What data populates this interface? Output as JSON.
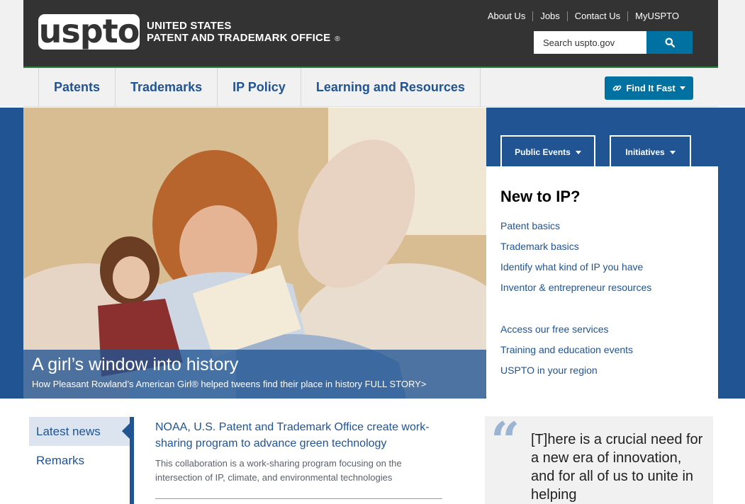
{
  "header": {
    "logo_text": "uspto",
    "office_line1": "UNITED STATES",
    "office_line2": "PATENT AND TRADEMARK OFFICE",
    "registered_mark": "®",
    "utility_links": [
      "About Us",
      "Jobs",
      "Contact Us",
      "MyUSPTO"
    ],
    "search_placeholder": "Search uspto.gov"
  },
  "nav": {
    "items": [
      "Patents",
      "Trademarks",
      "IP Policy",
      "Learning and Resources"
    ],
    "find_it_fast": "Find It Fast"
  },
  "hero": {
    "title": "A girl’s window into history",
    "subtitle": "How Pleasant Rowland’s American Girl® helped tweens find their place in history FULL STORY>"
  },
  "panel": {
    "tabs": [
      "Public Events",
      "Initiatives"
    ],
    "heading": "New to IP?",
    "links_group1": [
      "Patent basics",
      "Trademark basics",
      "Identify what kind of IP you have",
      "Inventor & entrepreneur resources"
    ],
    "links_group2": [
      "Access our free services",
      "Training and education events",
      "USPTO in your region"
    ]
  },
  "news": {
    "tabs": [
      "Latest news",
      "Remarks"
    ],
    "item_title": "NOAA, U.S. Patent and Trademark Office create work-sharing program to advance green technology",
    "item_desc": "This collaboration is a work-sharing program focusing on the intersection of IP, climate, and environmental technologies"
  },
  "quote": {
    "mark": "“",
    "text": "[T]here is a crucial need for a new era of innovation, and for all of us to unite in helping"
  },
  "colors": {
    "header_bg": "#333333",
    "brand_blue": "#205493",
    "button_blue": "#0071a1",
    "accent_green": "#2e8540"
  }
}
